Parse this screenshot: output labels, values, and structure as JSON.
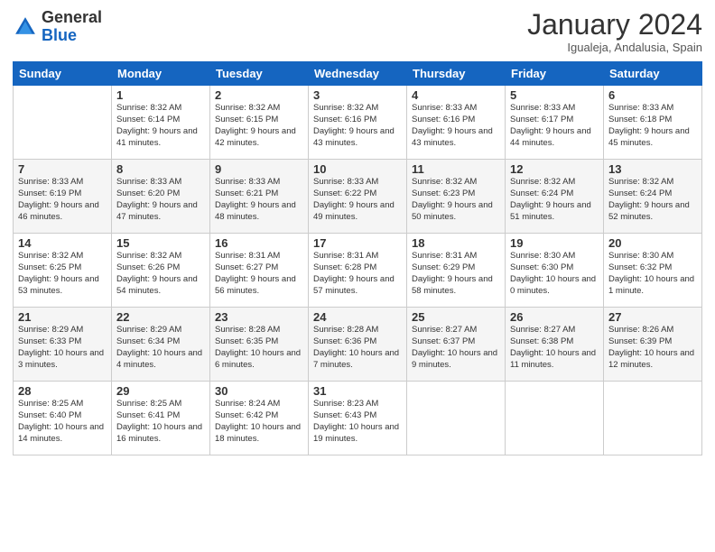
{
  "logo": {
    "general": "General",
    "blue": "Blue"
  },
  "header": {
    "month": "January 2024",
    "location": "Igualeja, Andalusia, Spain"
  },
  "days_of_week": [
    "Sunday",
    "Monday",
    "Tuesday",
    "Wednesday",
    "Thursday",
    "Friday",
    "Saturday"
  ],
  "weeks": [
    [
      {
        "day": "",
        "sunrise": "",
        "sunset": "",
        "daylight": ""
      },
      {
        "day": "1",
        "sunrise": "Sunrise: 8:32 AM",
        "sunset": "Sunset: 6:14 PM",
        "daylight": "Daylight: 9 hours and 41 minutes."
      },
      {
        "day": "2",
        "sunrise": "Sunrise: 8:32 AM",
        "sunset": "Sunset: 6:15 PM",
        "daylight": "Daylight: 9 hours and 42 minutes."
      },
      {
        "day": "3",
        "sunrise": "Sunrise: 8:32 AM",
        "sunset": "Sunset: 6:16 PM",
        "daylight": "Daylight: 9 hours and 43 minutes."
      },
      {
        "day": "4",
        "sunrise": "Sunrise: 8:33 AM",
        "sunset": "Sunset: 6:16 PM",
        "daylight": "Daylight: 9 hours and 43 minutes."
      },
      {
        "day": "5",
        "sunrise": "Sunrise: 8:33 AM",
        "sunset": "Sunset: 6:17 PM",
        "daylight": "Daylight: 9 hours and 44 minutes."
      },
      {
        "day": "6",
        "sunrise": "Sunrise: 8:33 AM",
        "sunset": "Sunset: 6:18 PM",
        "daylight": "Daylight: 9 hours and 45 minutes."
      }
    ],
    [
      {
        "day": "7",
        "sunrise": "Sunrise: 8:33 AM",
        "sunset": "Sunset: 6:19 PM",
        "daylight": "Daylight: 9 hours and 46 minutes."
      },
      {
        "day": "8",
        "sunrise": "Sunrise: 8:33 AM",
        "sunset": "Sunset: 6:20 PM",
        "daylight": "Daylight: 9 hours and 47 minutes."
      },
      {
        "day": "9",
        "sunrise": "Sunrise: 8:33 AM",
        "sunset": "Sunset: 6:21 PM",
        "daylight": "Daylight: 9 hours and 48 minutes."
      },
      {
        "day": "10",
        "sunrise": "Sunrise: 8:33 AM",
        "sunset": "Sunset: 6:22 PM",
        "daylight": "Daylight: 9 hours and 49 minutes."
      },
      {
        "day": "11",
        "sunrise": "Sunrise: 8:32 AM",
        "sunset": "Sunset: 6:23 PM",
        "daylight": "Daylight: 9 hours and 50 minutes."
      },
      {
        "day": "12",
        "sunrise": "Sunrise: 8:32 AM",
        "sunset": "Sunset: 6:24 PM",
        "daylight": "Daylight: 9 hours and 51 minutes."
      },
      {
        "day": "13",
        "sunrise": "Sunrise: 8:32 AM",
        "sunset": "Sunset: 6:24 PM",
        "daylight": "Daylight: 9 hours and 52 minutes."
      }
    ],
    [
      {
        "day": "14",
        "sunrise": "Sunrise: 8:32 AM",
        "sunset": "Sunset: 6:25 PM",
        "daylight": "Daylight: 9 hours and 53 minutes."
      },
      {
        "day": "15",
        "sunrise": "Sunrise: 8:32 AM",
        "sunset": "Sunset: 6:26 PM",
        "daylight": "Daylight: 9 hours and 54 minutes."
      },
      {
        "day": "16",
        "sunrise": "Sunrise: 8:31 AM",
        "sunset": "Sunset: 6:27 PM",
        "daylight": "Daylight: 9 hours and 56 minutes."
      },
      {
        "day": "17",
        "sunrise": "Sunrise: 8:31 AM",
        "sunset": "Sunset: 6:28 PM",
        "daylight": "Daylight: 9 hours and 57 minutes."
      },
      {
        "day": "18",
        "sunrise": "Sunrise: 8:31 AM",
        "sunset": "Sunset: 6:29 PM",
        "daylight": "Daylight: 9 hours and 58 minutes."
      },
      {
        "day": "19",
        "sunrise": "Sunrise: 8:30 AM",
        "sunset": "Sunset: 6:30 PM",
        "daylight": "Daylight: 10 hours and 0 minutes."
      },
      {
        "day": "20",
        "sunrise": "Sunrise: 8:30 AM",
        "sunset": "Sunset: 6:32 PM",
        "daylight": "Daylight: 10 hours and 1 minute."
      }
    ],
    [
      {
        "day": "21",
        "sunrise": "Sunrise: 8:29 AM",
        "sunset": "Sunset: 6:33 PM",
        "daylight": "Daylight: 10 hours and 3 minutes."
      },
      {
        "day": "22",
        "sunrise": "Sunrise: 8:29 AM",
        "sunset": "Sunset: 6:34 PM",
        "daylight": "Daylight: 10 hours and 4 minutes."
      },
      {
        "day": "23",
        "sunrise": "Sunrise: 8:28 AM",
        "sunset": "Sunset: 6:35 PM",
        "daylight": "Daylight: 10 hours and 6 minutes."
      },
      {
        "day": "24",
        "sunrise": "Sunrise: 8:28 AM",
        "sunset": "Sunset: 6:36 PM",
        "daylight": "Daylight: 10 hours and 7 minutes."
      },
      {
        "day": "25",
        "sunrise": "Sunrise: 8:27 AM",
        "sunset": "Sunset: 6:37 PM",
        "daylight": "Daylight: 10 hours and 9 minutes."
      },
      {
        "day": "26",
        "sunrise": "Sunrise: 8:27 AM",
        "sunset": "Sunset: 6:38 PM",
        "daylight": "Daylight: 10 hours and 11 minutes."
      },
      {
        "day": "27",
        "sunrise": "Sunrise: 8:26 AM",
        "sunset": "Sunset: 6:39 PM",
        "daylight": "Daylight: 10 hours and 12 minutes."
      }
    ],
    [
      {
        "day": "28",
        "sunrise": "Sunrise: 8:25 AM",
        "sunset": "Sunset: 6:40 PM",
        "daylight": "Daylight: 10 hours and 14 minutes."
      },
      {
        "day": "29",
        "sunrise": "Sunrise: 8:25 AM",
        "sunset": "Sunset: 6:41 PM",
        "daylight": "Daylight: 10 hours and 16 minutes."
      },
      {
        "day": "30",
        "sunrise": "Sunrise: 8:24 AM",
        "sunset": "Sunset: 6:42 PM",
        "daylight": "Daylight: 10 hours and 18 minutes."
      },
      {
        "day": "31",
        "sunrise": "Sunrise: 8:23 AM",
        "sunset": "Sunset: 6:43 PM",
        "daylight": "Daylight: 10 hours and 19 minutes."
      },
      {
        "day": "",
        "sunrise": "",
        "sunset": "",
        "daylight": ""
      },
      {
        "day": "",
        "sunrise": "",
        "sunset": "",
        "daylight": ""
      },
      {
        "day": "",
        "sunrise": "",
        "sunset": "",
        "daylight": ""
      }
    ]
  ]
}
